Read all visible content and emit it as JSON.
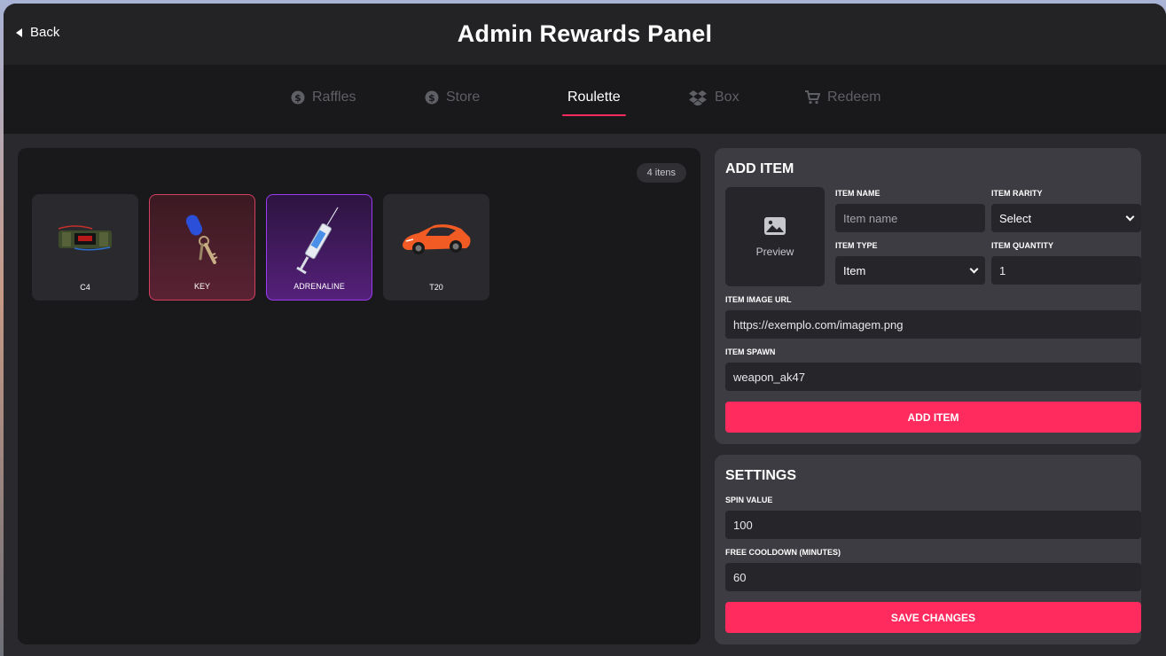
{
  "header": {
    "back_label": "Back",
    "title": "Admin Rewards Panel"
  },
  "tabs": [
    {
      "label": "Raffles",
      "icon": "dollar-coin-icon",
      "active": false
    },
    {
      "label": "Store",
      "icon": "dollar-coin-icon",
      "active": false
    },
    {
      "label": "Roulette",
      "icon": "",
      "active": true
    },
    {
      "label": "Box",
      "icon": "dropbox-icon",
      "active": false
    },
    {
      "label": "Redeem",
      "icon": "cart-icon",
      "active": false
    }
  ],
  "items_panel": {
    "count_label": "4 itens",
    "items": [
      {
        "label": "C4",
        "icon": "c4-explosive-icon",
        "rarity": "common"
      },
      {
        "label": "KEY",
        "icon": "key-icon",
        "rarity": "rare"
      },
      {
        "label": "ADRENALINE",
        "icon": "syringe-icon",
        "rarity": "epic"
      },
      {
        "label": "T20",
        "icon": "sports-car-icon",
        "rarity": "common"
      }
    ]
  },
  "add_item": {
    "title": "ADD ITEM",
    "preview_label": "Preview",
    "name_label": "ITEM NAME",
    "name_placeholder": "Item name",
    "rarity_label": "ITEM RARITY",
    "rarity_value": "Select",
    "type_label": "ITEM TYPE",
    "type_value": "Item",
    "quantity_label": "ITEM QUANTITY",
    "quantity_value": "1",
    "image_url_label": "ITEM IMAGE URL",
    "image_url_value": "https://exemplo.com/imagem.png",
    "spawn_label": "ITEM SPAWN",
    "spawn_value": "weapon_ak47",
    "button_label": "ADD ITEM"
  },
  "settings": {
    "title": "SETTINGS",
    "spin_label": "SPIN VALUE",
    "spin_value": "100",
    "cooldown_label": "FREE COOLDOWN (MINUTES)",
    "cooldown_value": "60",
    "button_label": "SAVE CHANGES"
  },
  "colors": {
    "accent": "#ff2b5e",
    "rare": "#d3405f",
    "epic": "#9c3cf0"
  }
}
